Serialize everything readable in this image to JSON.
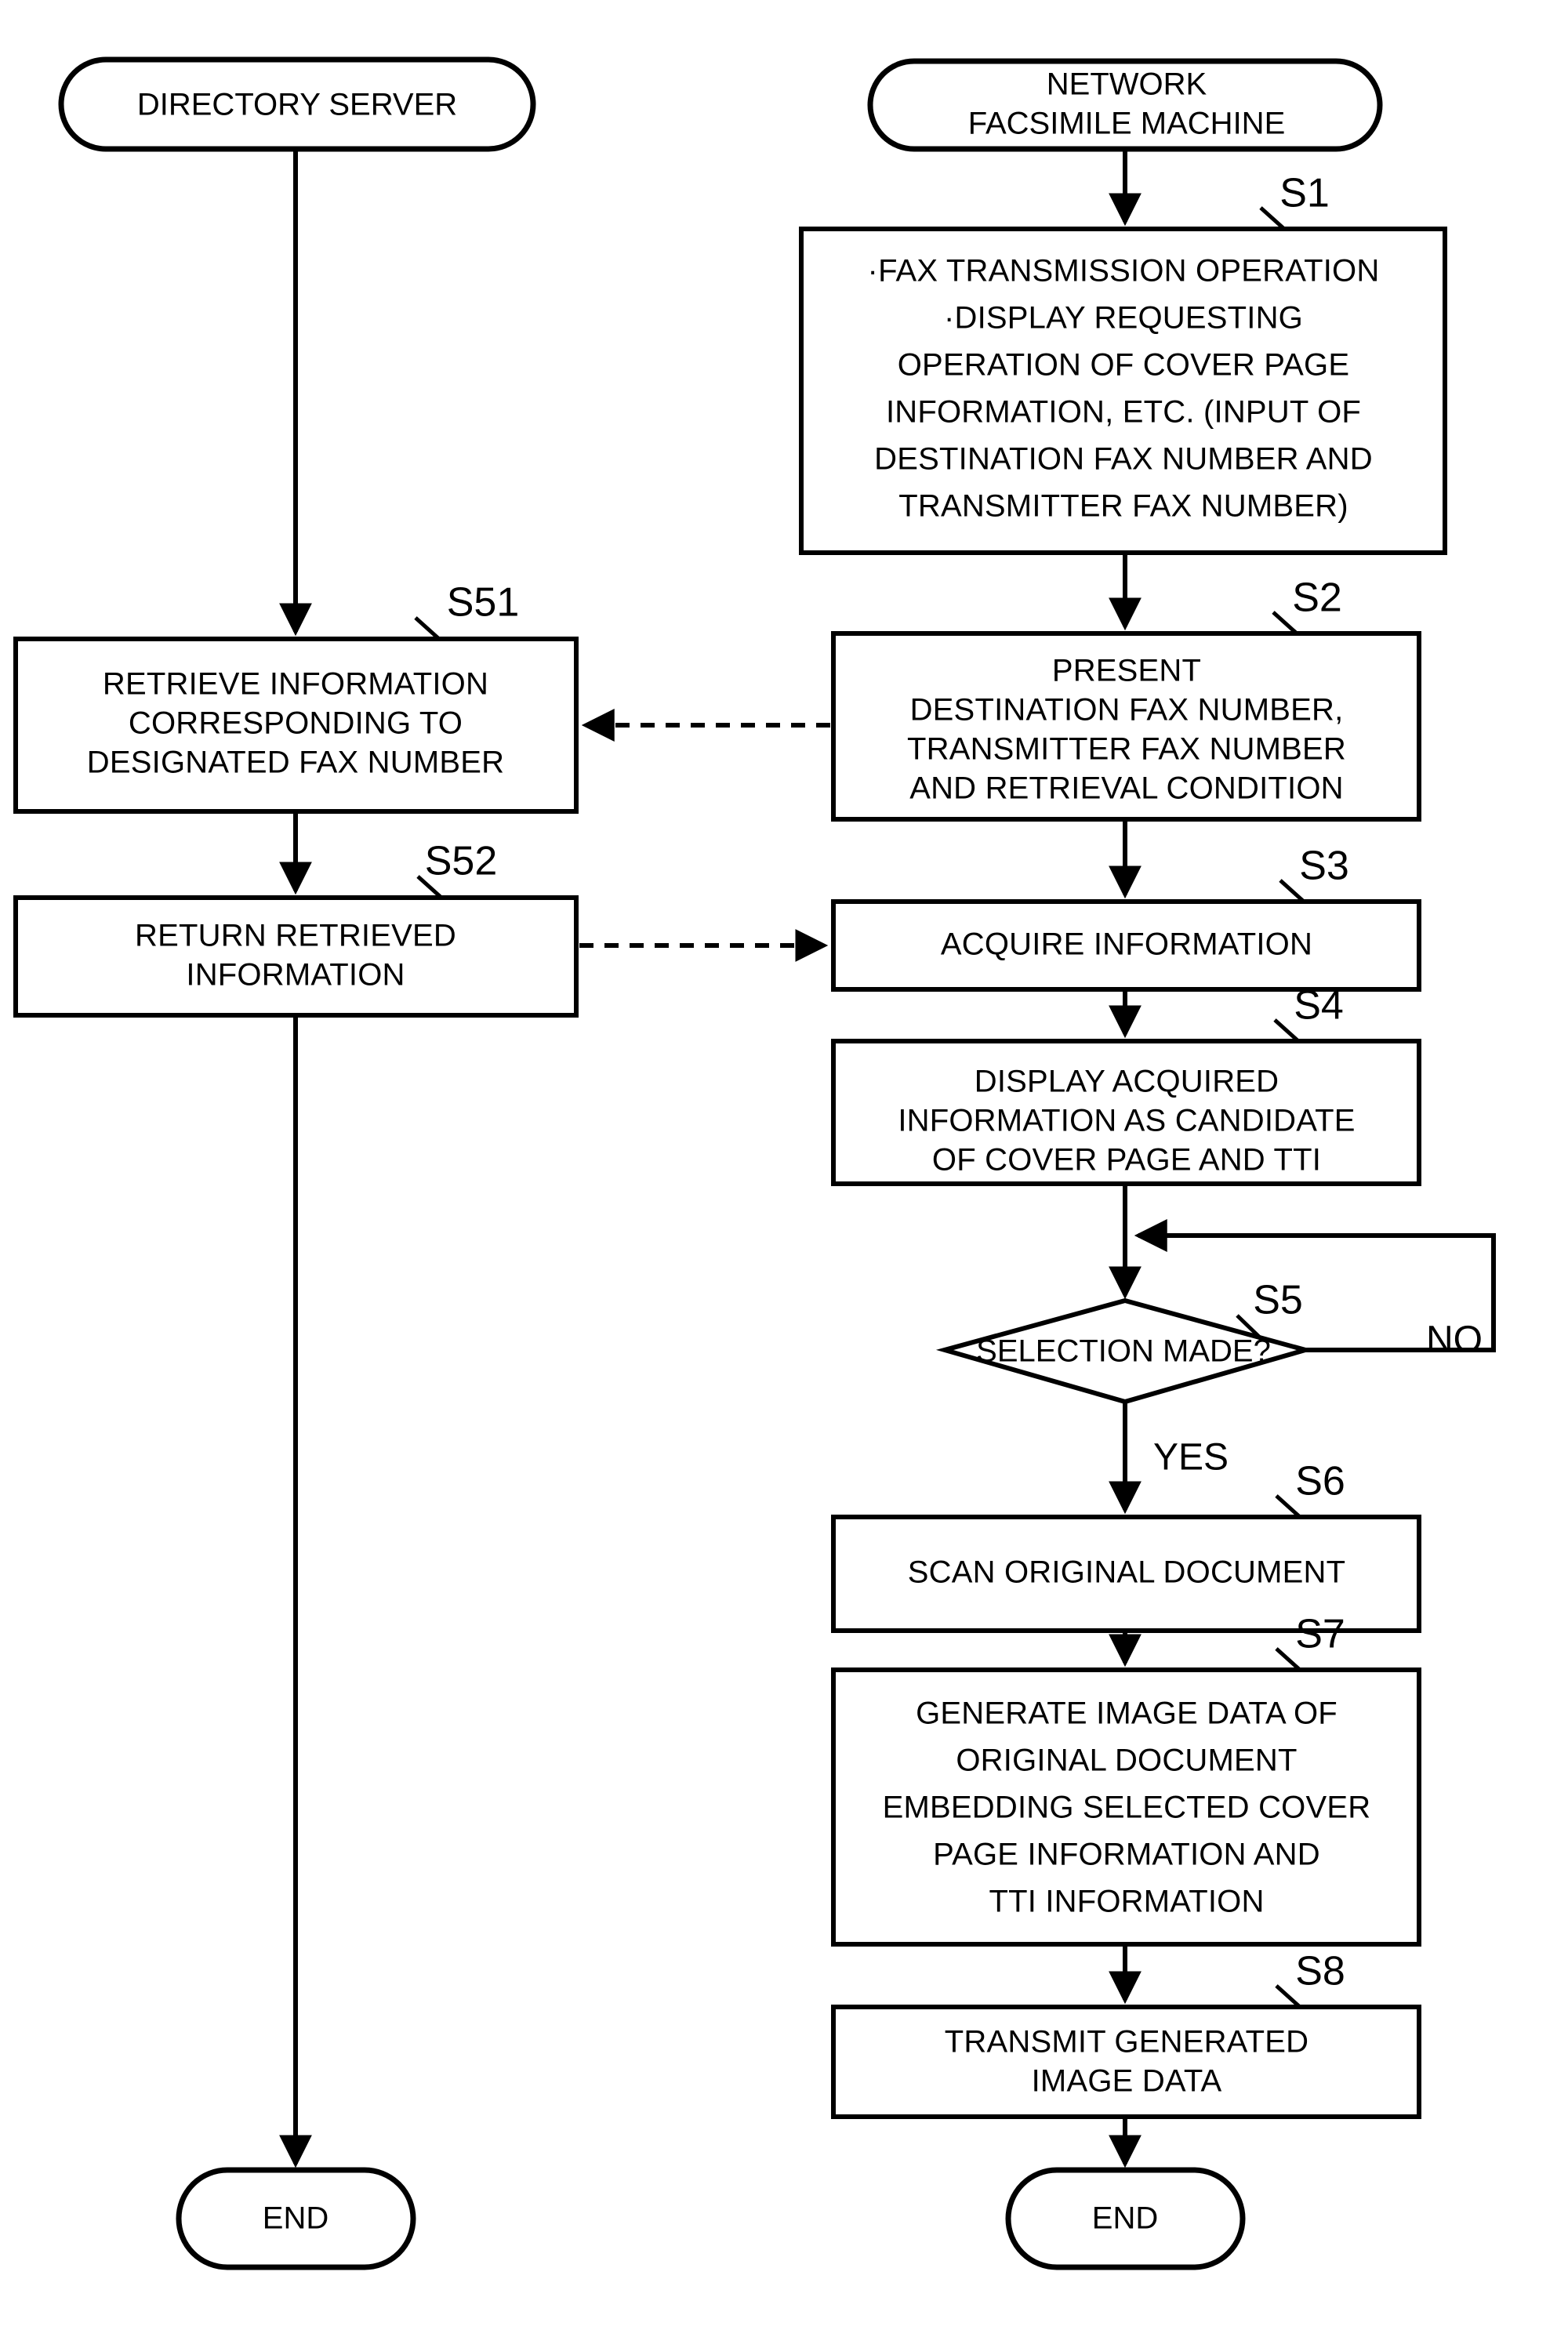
{
  "diagram": {
    "title": "Network facsimile machine and directory server cover page flowchart",
    "lanes": [
      {
        "id": "directory-server",
        "label": "DIRECTORY SERVER"
      },
      {
        "id": "network-fax",
        "label": "NETWORK\nFACSIMILE MACHINE"
      }
    ],
    "terminators": {
      "directory_server": "DIRECTORY SERVER",
      "network_fax_line1": "NETWORK",
      "network_fax_line2": "FACSIMILE MACHINE",
      "end_left": "END",
      "end_right": "END"
    },
    "branch_labels": {
      "no": "NO",
      "yes": "YES"
    },
    "nodes": [
      {
        "id": "S1",
        "step": "S1",
        "lane": "network-fax",
        "shape": "process",
        "lines": [
          "·FAX TRANSMISSION OPERATION",
          "·DISPLAY REQUESTING",
          "OPERATION OF COVER PAGE",
          "INFORMATION, ETC. (INPUT OF",
          "DESTINATION FAX NUMBER AND",
          "TRANSMITTER FAX NUMBER)"
        ]
      },
      {
        "id": "S2",
        "step": "S2",
        "lane": "network-fax",
        "shape": "process",
        "lines": [
          "PRESENT",
          "DESTINATION FAX NUMBER,",
          "TRANSMITTER FAX NUMBER",
          "AND RETRIEVAL CONDITION"
        ]
      },
      {
        "id": "S3",
        "step": "S3",
        "lane": "network-fax",
        "shape": "process",
        "lines": [
          "ACQUIRE INFORMATION"
        ]
      },
      {
        "id": "S4",
        "step": "S4",
        "lane": "network-fax",
        "shape": "process",
        "lines": [
          "DISPLAY ACQUIRED",
          "INFORMATION AS CANDIDATE",
          "OF COVER PAGE AND TTI"
        ]
      },
      {
        "id": "S5",
        "step": "S5",
        "lane": "network-fax",
        "shape": "decision",
        "lines": [
          "SELECTION MADE?"
        ]
      },
      {
        "id": "S6",
        "step": "S6",
        "lane": "network-fax",
        "shape": "process",
        "lines": [
          "SCAN ORIGINAL DOCUMENT"
        ]
      },
      {
        "id": "S7",
        "step": "S7",
        "lane": "network-fax",
        "shape": "process",
        "lines": [
          "GENERATE IMAGE DATA OF",
          "ORIGINAL DOCUMENT",
          "EMBEDDING SELECTED COVER",
          "PAGE INFORMATION AND",
          "TTI INFORMATION"
        ]
      },
      {
        "id": "S8",
        "step": "S8",
        "lane": "network-fax",
        "shape": "process",
        "lines": [
          "TRANSMIT GENERATED",
          "IMAGE DATA"
        ]
      },
      {
        "id": "S51",
        "step": "S51",
        "lane": "directory-server",
        "shape": "process",
        "lines": [
          "RETRIEVE INFORMATION",
          "CORRESPONDING TO",
          "DESIGNATED FAX NUMBER"
        ]
      },
      {
        "id": "S52",
        "step": "S52",
        "lane": "directory-server",
        "shape": "process",
        "lines": [
          "RETURN RETRIEVED",
          "INFORMATION"
        ]
      }
    ],
    "edges": [
      {
        "from": "directory-server-start",
        "to": "S51",
        "style": "solid"
      },
      {
        "from": "S51",
        "to": "S52",
        "style": "solid"
      },
      {
        "from": "S52",
        "to": "end-left",
        "style": "solid"
      },
      {
        "from": "network-fax-start",
        "to": "S1",
        "style": "solid"
      },
      {
        "from": "S1",
        "to": "S2",
        "style": "solid"
      },
      {
        "from": "S2",
        "to": "S51",
        "style": "dashed"
      },
      {
        "from": "S52",
        "to": "S3",
        "style": "dashed"
      },
      {
        "from": "S3",
        "to": "S4",
        "style": "solid"
      },
      {
        "from": "S4",
        "to": "S5",
        "style": "solid"
      },
      {
        "from": "S5",
        "to": "S6",
        "style": "solid",
        "label": "YES"
      },
      {
        "from": "S5",
        "to": "S5-loop",
        "style": "solid",
        "label": "NO"
      },
      {
        "from": "S6",
        "to": "S7",
        "style": "solid"
      },
      {
        "from": "S7",
        "to": "S8",
        "style": "solid"
      },
      {
        "from": "S8",
        "to": "end-right",
        "style": "solid"
      }
    ],
    "colors": {
      "stroke": "#000000",
      "fill": "#ffffff",
      "text": "#000000"
    }
  }
}
